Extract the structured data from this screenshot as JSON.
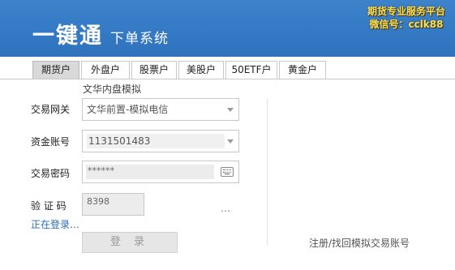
{
  "header": {
    "title": "一键通",
    "subtitle": "下单系统",
    "promo_line1": "期货专业服务平台",
    "promo_line2": "微信号：cclk88"
  },
  "tabs": [
    {
      "label": "期货户",
      "active": true
    },
    {
      "label": "外盘户",
      "active": false
    },
    {
      "label": "股票户",
      "active": false
    },
    {
      "label": "美股户",
      "active": false
    },
    {
      "label": "50ETF户",
      "active": false
    },
    {
      "label": "黄金户",
      "active": false
    }
  ],
  "form": {
    "sub_title": "文华内盘模拟",
    "gateway_label": "交易网关",
    "gateway_value": "文华前置-模拟电信",
    "account_label": "资金账号",
    "account_value": "1131501483",
    "password_label": "交易密码",
    "password_value": "******",
    "captcha_label": "验 证 码",
    "captcha_value": "8398",
    "captcha_image": "…"
  },
  "status_text": "正在登录…",
  "login_label": "登 录",
  "register_link": "注册/找回模拟交易账号",
  "colors": {
    "header_bg": "#2f72bd",
    "promo_text": "#f0e060",
    "status_text": "#2b6cb3"
  }
}
